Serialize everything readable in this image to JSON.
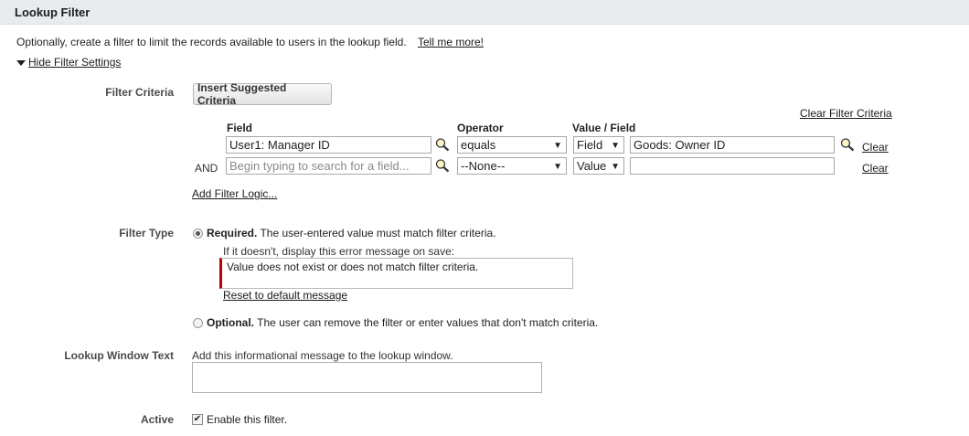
{
  "section": {
    "title": "Lookup Filter"
  },
  "intro": {
    "text": "Optionally, create a filter to limit the records available to users in the lookup field.",
    "tell_me_more": "Tell me more!",
    "hide_settings": "Hide Filter Settings"
  },
  "criteria": {
    "label": "Filter Criteria",
    "insert_button": "Insert Suggested Criteria",
    "clear_all": "Clear Filter Criteria",
    "headers": {
      "field": "Field",
      "operator": "Operator",
      "value_field": "Value / Field"
    },
    "rows": [
      {
        "prefix": "",
        "field": "User1: Manager ID",
        "field_placeholder": "",
        "operator": "equals",
        "value_type": "Field",
        "value": "Goods: Owner ID",
        "clear": "Clear"
      },
      {
        "prefix": "AND",
        "field": "",
        "field_placeholder": "Begin typing to search for a field...",
        "operator": "--None--",
        "value_type": "Value",
        "value": "",
        "clear": "Clear"
      }
    ],
    "add_logic": "Add Filter Logic..."
  },
  "filter_type": {
    "label": "Filter Type",
    "required_bold": "Required.",
    "required_text": "The user-entered value must match filter criteria.",
    "error_prompt": "If it doesn't, display this error message on save:",
    "error_message": "Value does not exist or does not match filter criteria.",
    "reset": "Reset to default message",
    "optional_bold": "Optional.",
    "optional_text": "The user can remove the filter or enter values that don't match criteria."
  },
  "lookup_window": {
    "label": "Lookup Window Text",
    "hint": "Add this informational message to the lookup window."
  },
  "active": {
    "label": "Active",
    "checkbox_label": "Enable this filter.",
    "checked": "✔"
  },
  "icons": {
    "lookup": "magnifier-lookup-icon",
    "expand": "triangle-down-icon"
  },
  "colors": {
    "header_bg": "#e8ecef",
    "error_bar": "#c00000"
  }
}
